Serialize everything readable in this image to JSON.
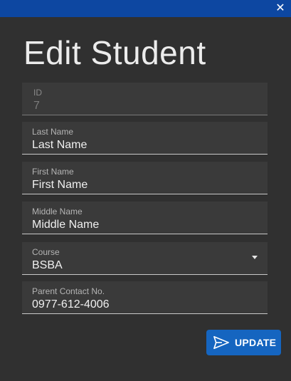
{
  "window": {
    "close_glyph": "✕",
    "titlebar_color": "#0d47a1"
  },
  "page": {
    "title": "Edit Student"
  },
  "form": {
    "id": {
      "label": "ID",
      "value": "7"
    },
    "last_name": {
      "label": "Last Name",
      "value": "Last Name"
    },
    "first_name": {
      "label": "First Name",
      "value": "First Name"
    },
    "middle_name": {
      "label": "Middle Name",
      "value": "Middle Name"
    },
    "course": {
      "label": "Course",
      "value": "BSBA"
    },
    "parent_contact": {
      "label": "Parent Contact No.",
      "value": "0977-612-4006"
    }
  },
  "actions": {
    "update_label": "UPDATE",
    "update_icon": "send-icon",
    "accent_color": "#1565c0"
  }
}
